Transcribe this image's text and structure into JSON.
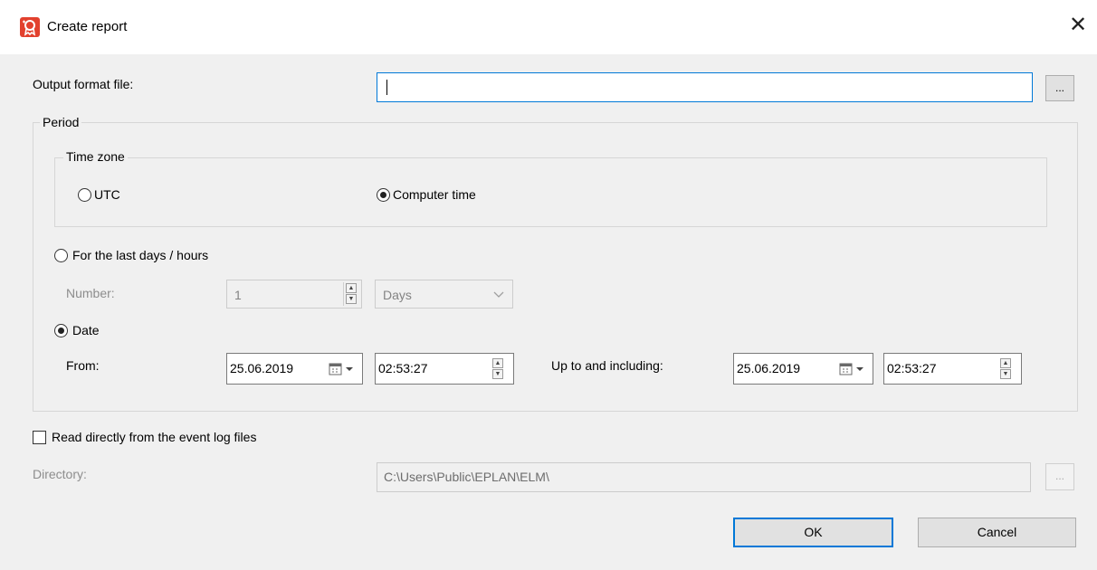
{
  "window": {
    "title": "Create report",
    "close_glyph": "✕"
  },
  "output": {
    "label": "Output format file:",
    "value": "",
    "browse_label": "..."
  },
  "period": {
    "legend": "Period",
    "timezone": {
      "legend": "Time zone",
      "utc_label": "UTC",
      "computer_label": "Computer time",
      "selected": "computer"
    },
    "last": {
      "label": "For the last days / hours",
      "number_label": "Number:",
      "number_value": "1",
      "unit_value": "Days"
    },
    "date": {
      "label": "Date",
      "from_label": "From:",
      "from_date": "25.06.2019",
      "from_time": "02:53:27",
      "to_label": "Up to and including:",
      "to_date": "25.06.2019",
      "to_time": "02:53:27"
    },
    "selected": "date"
  },
  "read_direct": {
    "label": "Read directly from the event log files",
    "checked": false
  },
  "directory": {
    "label": "Directory:",
    "value": "C:\\Users\\Public\\EPLAN\\ELM\\",
    "browse_label": "..."
  },
  "buttons": {
    "ok": "OK",
    "cancel": "Cancel"
  },
  "colors": {
    "accent": "#0078d7",
    "app_icon": "#e2412e"
  }
}
